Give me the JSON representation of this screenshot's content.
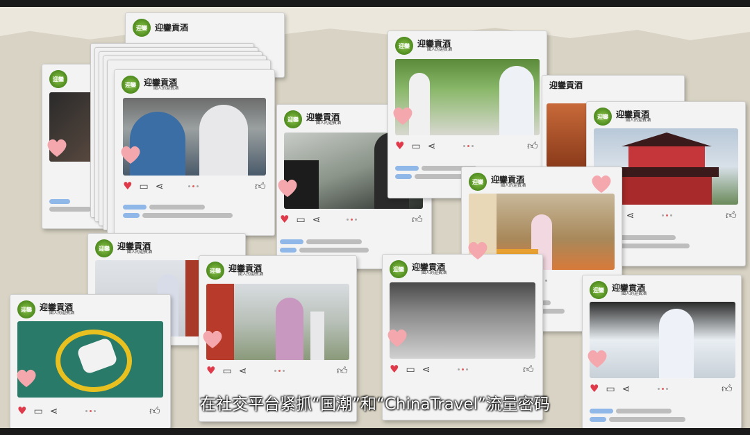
{
  "brand": {
    "logo_text": "迎鑾",
    "name": "迎鑾貢酒",
    "tagline": "國人的迎賓酒"
  },
  "subtitle": "在社交平台紧抓“国潮”和“ChinaTravel”流量密码",
  "colors": {
    "heart": "#e03a4a",
    "bubble": "#f4a8ae",
    "placeholder_blue": "#8fb8e8",
    "placeholder_gray": "#bdbdbd"
  },
  "icons": [
    "heart-icon",
    "comment-icon",
    "share-icon",
    "thumbs-up-icon",
    "logo-icon"
  ],
  "posts": [
    {
      "id": "p1",
      "scene": "photographer filming man drinking"
    },
    {
      "id": "p2",
      "scene": "helicopter cockpit pilot"
    },
    {
      "id": "p3",
      "scene": "film crew in greenhouse"
    },
    {
      "id": "p4",
      "scene": "pagoda palace"
    },
    {
      "id": "p5",
      "scene": "exhibition hall woman in hanfu"
    },
    {
      "id": "p6",
      "scene": "woman in hanfu with bottle"
    },
    {
      "id": "p7",
      "scene": "helicopter on helipad"
    },
    {
      "id": "p8",
      "scene": "woman in hanfu on terrace"
    }
  ]
}
